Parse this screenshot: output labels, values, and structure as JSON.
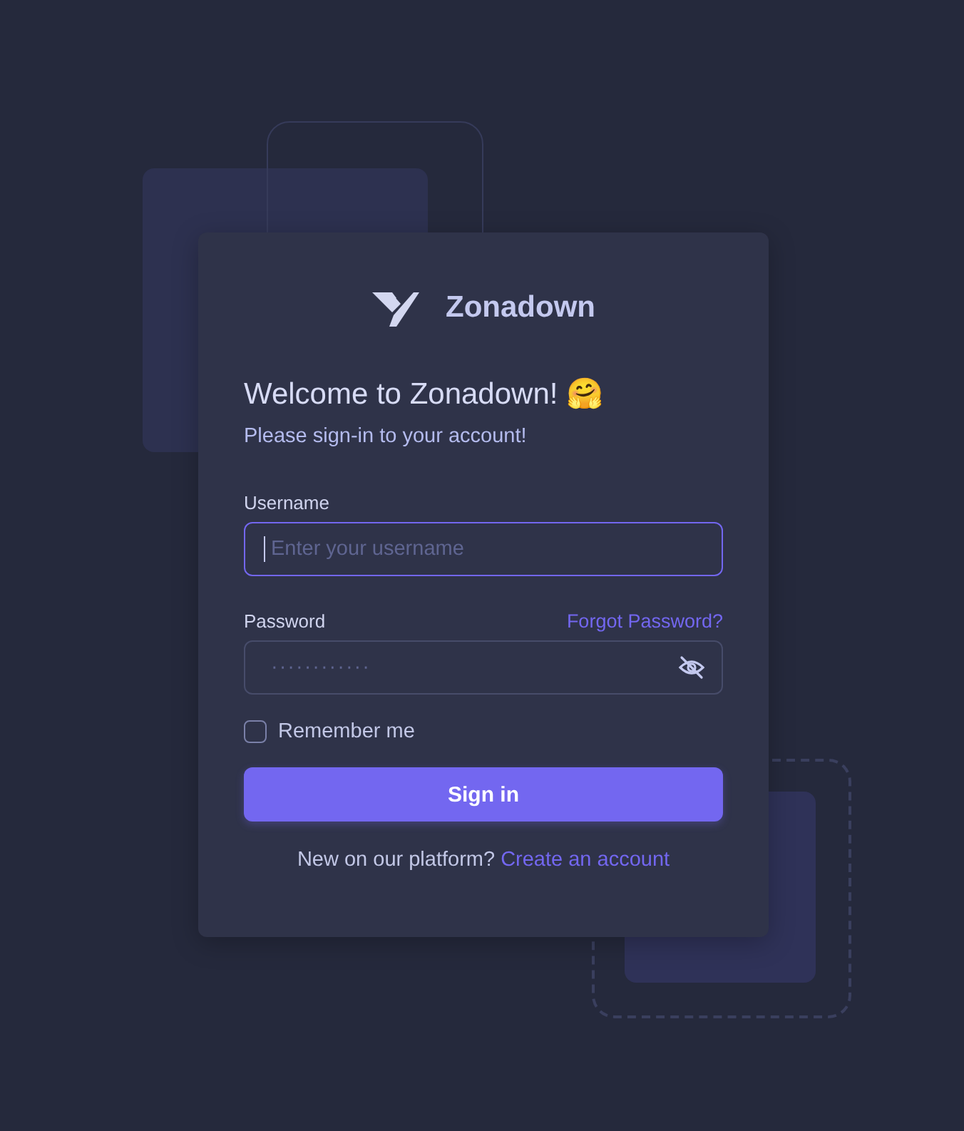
{
  "brand": {
    "name": "Zonadown"
  },
  "heading": {
    "title": "Welcome to Zonadown! 🤗",
    "subtitle": "Please sign-in to your account!"
  },
  "fields": [
    {
      "kind": "text",
      "label": "Username",
      "placeholder": "Enter your username",
      "focused": true
    },
    {
      "kind": "password",
      "label": "Password",
      "placeholder": "············",
      "link": "Forgot Password?",
      "focused": false
    }
  ],
  "remember": {
    "label": "Remember me",
    "checked": false
  },
  "submit": {
    "label": "Sign in"
  },
  "footer": {
    "text": "New on our platform?",
    "link": "Create an account"
  }
}
